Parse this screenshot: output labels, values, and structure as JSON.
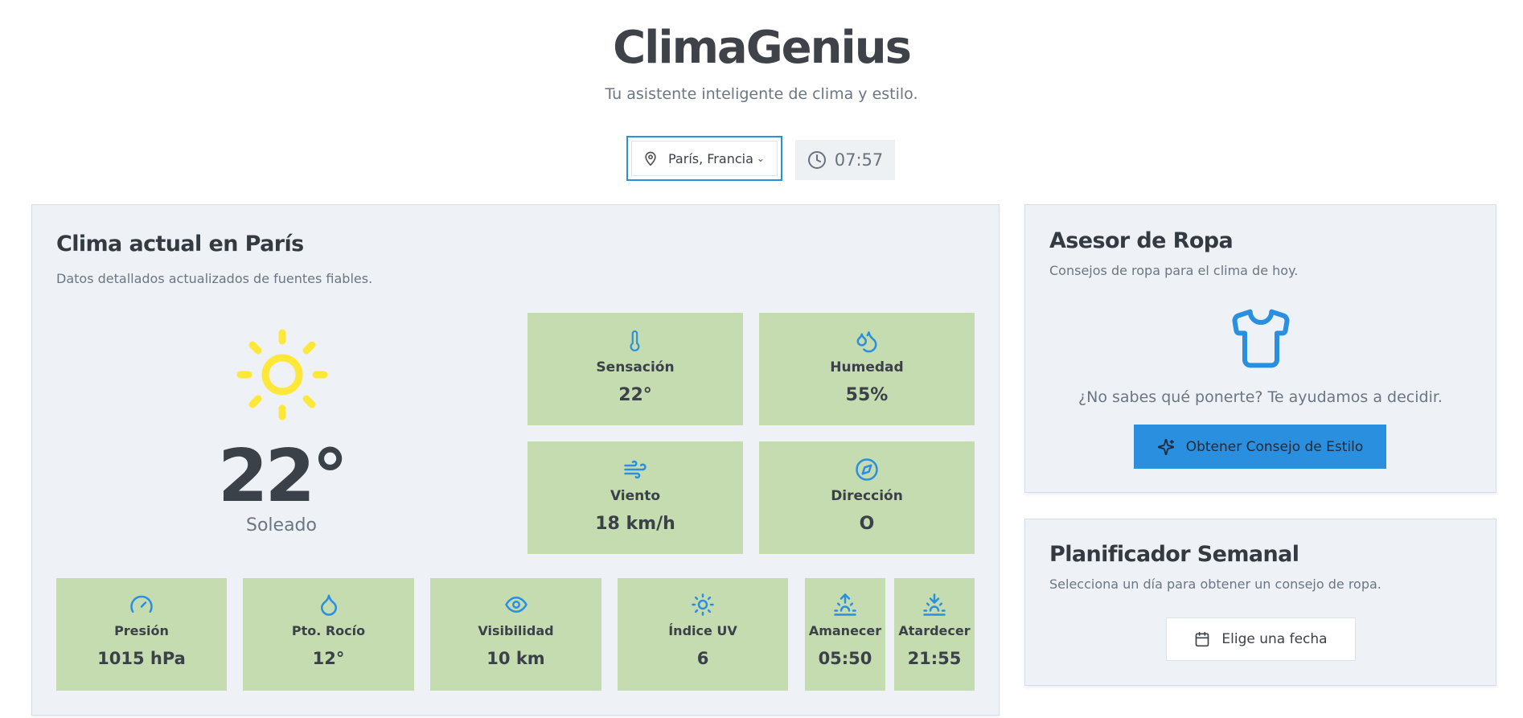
{
  "header": {
    "title": "ClimaGenius",
    "subtitle": "Tu asistente inteligente de clima y estilo.",
    "location": "París, Francia",
    "time": "07:57"
  },
  "current": {
    "title": "Clima actual en París",
    "description": "Datos detallados actualizados de fuentes fiables.",
    "temperature": "22°",
    "condition": "Soleado",
    "icon": "sun-icon",
    "sun_color": "#fde83a",
    "metrics": [
      {
        "label": "Sensación",
        "value": "22°",
        "icon": "thermometer-icon"
      },
      {
        "label": "Humedad",
        "value": "55%",
        "icon": "droplets-icon"
      },
      {
        "label": "Viento",
        "value": "18 km/h",
        "icon": "wind-icon"
      },
      {
        "label": "Dirección",
        "value": "O",
        "icon": "compass-icon"
      }
    ],
    "details": [
      {
        "label": "Presión",
        "value": "1015 hPa",
        "icon": "gauge-icon"
      },
      {
        "label": "Pto. Rocío",
        "value": "12°",
        "icon": "droplet-icon"
      },
      {
        "label": "Visibilidad",
        "value": "10 km",
        "icon": "eye-icon"
      },
      {
        "label": "Índice UV",
        "value": "6",
        "icon": "uv-sun-icon"
      },
      {
        "label": "Amanecer",
        "value": "05:50",
        "icon": "sunrise-icon"
      },
      {
        "label": "Atardecer",
        "value": "21:55",
        "icon": "sunset-icon"
      }
    ]
  },
  "style_advisor": {
    "title": "Asesor de Ropa",
    "description": "Consejos de ropa para el clima de hoy.",
    "question": "¿No sabes qué ponerte? Te ayudamos a decidir.",
    "button_label": "Obtener Consejo de Estilo",
    "icon": "shirt-icon"
  },
  "planner": {
    "title": "Planificador Semanal",
    "description": "Selecciona un día para obtener un consejo de ropa.",
    "button_label": "Elige una fecha"
  },
  "colors": {
    "accent": "#2b8fe0",
    "tile_bg": "#c5dcb1",
    "card_bg": "#eef2f6"
  }
}
